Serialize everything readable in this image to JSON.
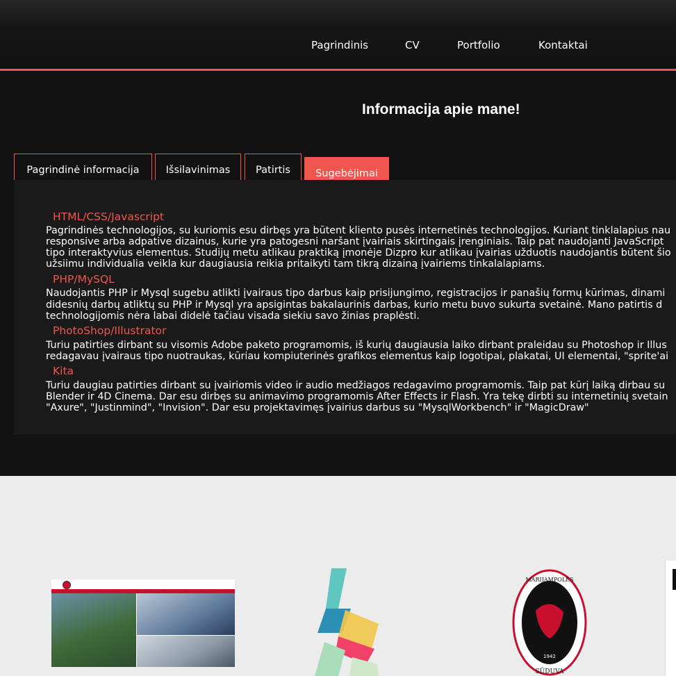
{
  "nav": {
    "items": [
      "Pagrindinis",
      "CV",
      "Portfolio",
      "Kontaktai"
    ]
  },
  "header": {
    "title": "Informacija apie mane!"
  },
  "tabs": [
    {
      "label": "Pagrindinė informacija",
      "active": false
    },
    {
      "label": "Išsilavinimas",
      "active": false
    },
    {
      "label": "Patirtis",
      "active": false
    },
    {
      "label": "Sugebėjimai",
      "active": true
    }
  ],
  "skills": [
    {
      "title": "HTML/CSS/Javascript",
      "lines": [
        "Pagrindinės technologijos, su kuriomis esu dirbęs yra būtent kliento pusės internetinės technologijos. Kuriant tinklalapius nau",
        "responsive arba adpative dizainus, kurie yra patogesni naršant įvairiais skirtingais įrenginiais. Taip pat naudojanti JavaScript",
        "tipo interaktyvius elementus. Studijų metu atlikau praktiką įmonėje Dizpro kur atlikau įvairias užduotis naudojantis būtent šio",
        "užsiimu individualia veikla kur daugiausia reikia pritaikyti tam tikrą dizainą įvairiems tinkalalapiams."
      ]
    },
    {
      "title": "PHP/MySQL",
      "lines": [
        "Naudojantis PHP ir Mysql sugebu atlikti įvairaus tipo darbus kaip prisijungimo, registracijos ir panašių formų kūrimas, dinami",
        "didesnių darbų atliktų su PHP ir Mysql yra apsigintas bakalaurinis darbas, kurio metu buvo sukurta svetainė. Mano patirtis d",
        "technologijomis nėra labai didelė tačiau visada siekiu savo žinias praplėsti."
      ]
    },
    {
      "title": "PhotoShop/Illustrator",
      "lines": [
        "Turiu patirties dirbant su visomis Adobe paketo programomis, iš kurių daugiausia laiko dirbant praleidau su Photoshop ir Illus",
        "redagavau įvairaus tipo nuotraukas, kūriau kompiuterinės grafikos elementus kaip logotipai, plakatai, UI elementai, \"sprite'ai"
      ]
    },
    {
      "title": "Kita",
      "lines": [
        "Turiu daugiau patirties dirbant su įvairiomis video ir audio medžiagos redagavimo programomis. Taip pat kūrį laiką dirbau su",
        "Blender ir 4D Cinema. Dar esu dirbęs su animavimo programomis After Effects ir Flash. Yra tekę dirbti su internetinių svetain",
        "\"Axure\", \"Justinmind\", \"Invision\". Dar esu projektavimęs įvairius darbus su \"MysqlWorkbench\" ir \"MagicDraw\""
      ]
    }
  ],
  "colors": {
    "accent": "#f0564d",
    "dark": "#121212",
    "panel": "#1a1a1a"
  },
  "portfolio": {
    "items": [
      "website-screenshot-thumbnail",
      "ribbon-logo",
      "suduva-crest-logo",
      "partial-card"
    ],
    "crest_top_text": "MARIJAMPOLĖS",
    "crest_bottom_text": "SŪDUVA",
    "crest_year": "1942"
  }
}
